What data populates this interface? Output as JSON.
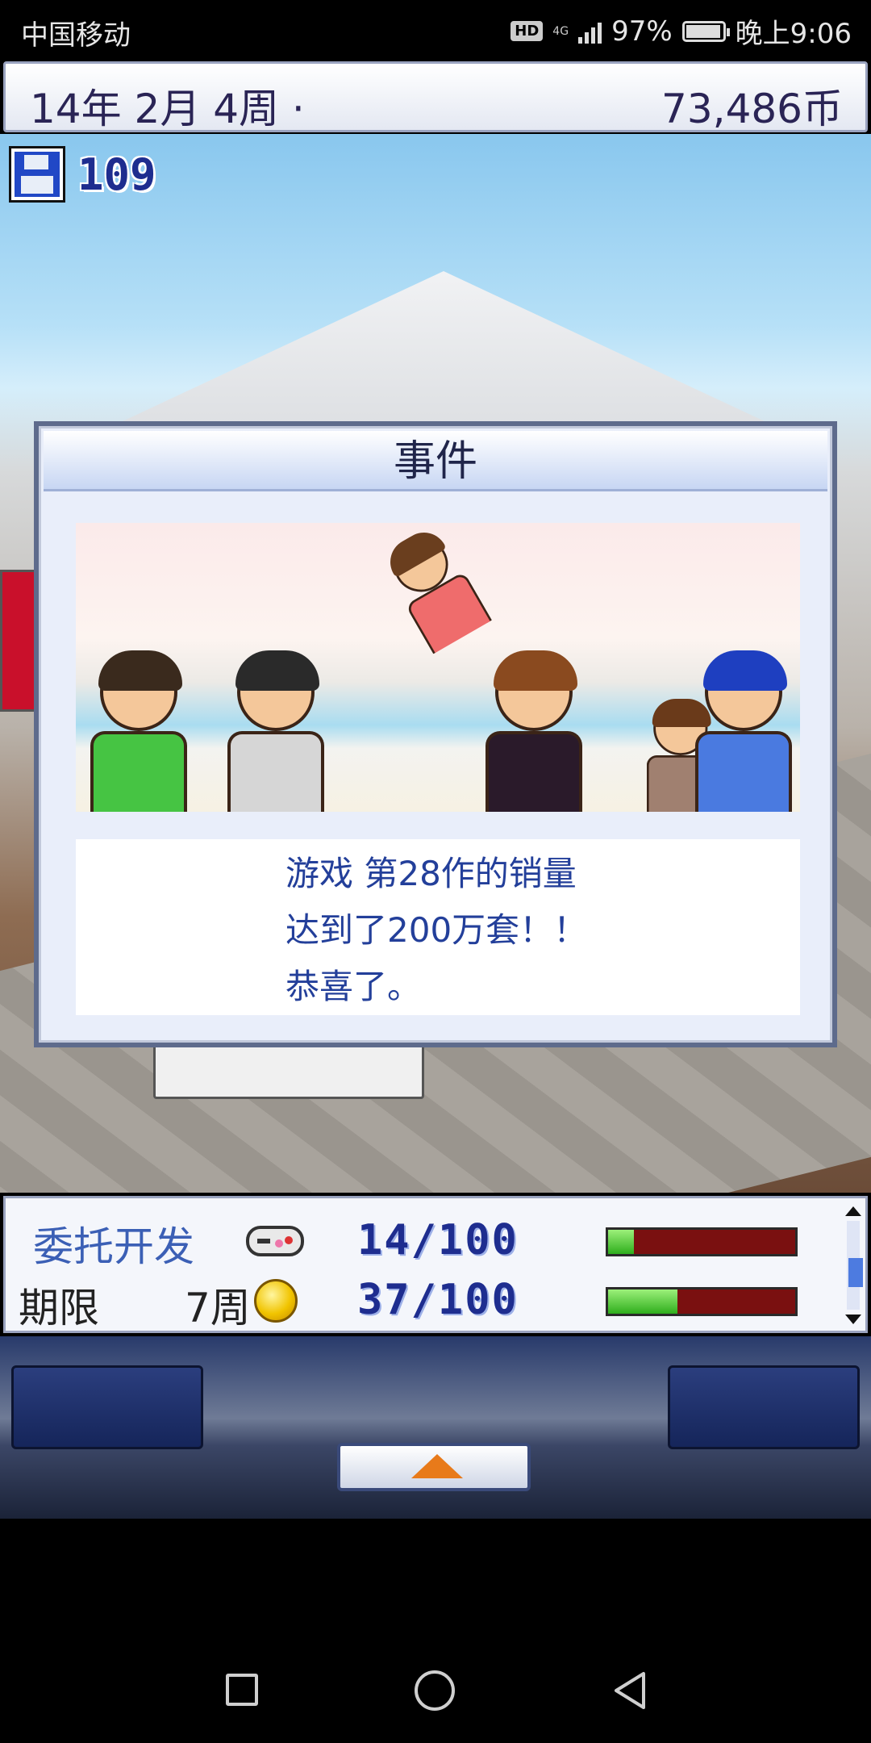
{
  "status_bar": {
    "carrier": "中国移动",
    "hd": "HD",
    "network": "4G",
    "battery_percent": "97%",
    "battery_level": 0.97,
    "time": "晚上9:06"
  },
  "hud": {
    "date": "14年 2月 4周 ·",
    "money": "73,486币"
  },
  "save": {
    "count": "109",
    "icon": "floppy-disk-icon"
  },
  "dialog": {
    "title": "事件",
    "message_lines": [
      "游戏 第28作的销量",
      "达到了200万套！！",
      "恭喜了。"
    ]
  },
  "info_panel": {
    "contract_label": "委托开发",
    "deadline_label": "期限",
    "deadline_value": "7周",
    "progress_1": "14/100",
    "progress_1_fraction": 0.14,
    "progress_2": "37/100",
    "progress_2_fraction": 0.37,
    "icons": [
      "controller-icon",
      "coin-icon"
    ]
  },
  "colors": {
    "accent_blue": "#233f9a",
    "bar_fill": "#2fae1d",
    "bar_empty": "#7a1010",
    "arrow_orange": "#e87a1a"
  }
}
